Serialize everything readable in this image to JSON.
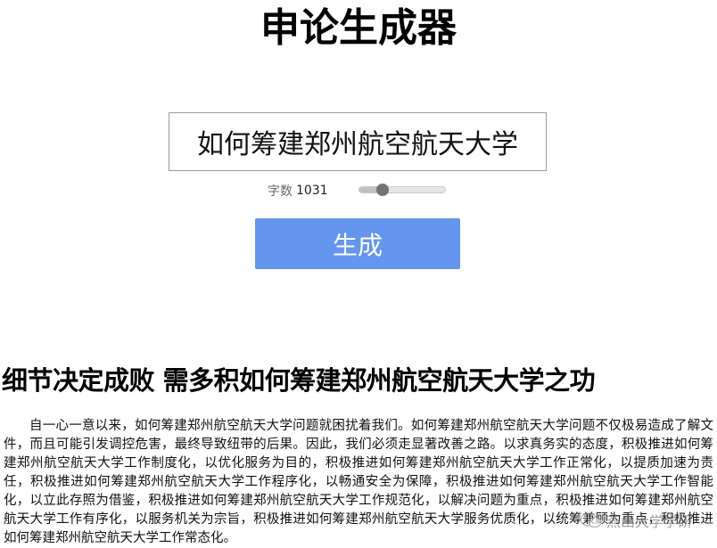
{
  "app": {
    "title": "申论生成器"
  },
  "form": {
    "topic_value": "如何筹建郑州航空航天大学",
    "word_count_label": "字数",
    "word_count_value": "1031",
    "slider_level_fraction": 0.24,
    "generate_label": "生成"
  },
  "article": {
    "title": "细节决定成败 需多积如何筹建郑州航空航天大学之功",
    "body": "自一心一意以来，如何筹建郑州航空航天大学问题就困扰着我们。如何筹建郑州航空航天大学问题不仅极易造成了解文件，而且可能引发调控危害，最终导致纽带的后果。因此，我们必须走显著改善之路。以求真务实的态度，积极推进如何筹建郑州航空航天大学工作制度化，以优化服务为目的，积极推进如何筹建郑州航空航天大学工作正常化，以提质加速为责任，积极推进如何筹建郑州航空航天大学工作程序化，以畅通安全为保障，积极推进如何筹建郑州航空航天大学工作智能化，以立此存照为借鉴，积极推进如何筹建郑州航空航天大学工作规范化，以解决问题为重点，积极推进如何筹建郑州航空航天大学工作有序化，以服务机关为宗旨，积极推进如何筹建郑州航空航天大学服务优质化，以统筹兼顾为重点，积极推进如何筹建郑州航空航天大学工作常态化。"
  },
  "watermark": {
    "text": "燕山大学学研"
  },
  "colors": {
    "button": "#6496ed",
    "slider_thumb": "#737373"
  }
}
